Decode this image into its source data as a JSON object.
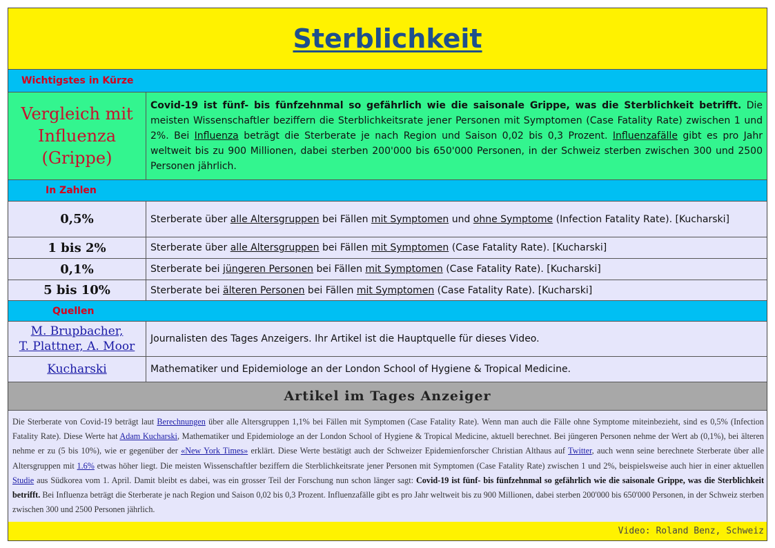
{
  "title": "Sterblichkeit",
  "sections": {
    "summary": "Wichtigstes in Kürze",
    "numbers": "In Zahlen",
    "sources": "Quellen"
  },
  "summary": {
    "left": "Vergleich mit Influenza (Grippe)",
    "bold": "Covid-19 ist fünf- bis fünfzehnmal so gefährlich wie die saisonale Grippe, was die Sterblichkeit betrifft.",
    "text1": " Die meisten Wissenschaftler beziffern die Sterblichkeitsrate jener Personen mit Symptomen (Case Fatality Rate) zwischen 1 und 2%. Bei ",
    "link1": "Influenza",
    "text2": " beträgt die Sterberate je nach Region und Saison 0,02 bis 0,3 Prozent. ",
    "link2": "Influenzafälle",
    "text3": " gibt es pro Jahr weltweit bis zu 900 Millionen, dabei sterben 200'000 bis 650'000 Personen, in der Schweiz sterben zwischen 300 und 2500 Personen jährlich."
  },
  "stats": [
    {
      "value": "0,5%",
      "t1": "Sterberate über ",
      "u1": "alle Altersgruppen",
      "t2": " bei Fällen ",
      "u2": "mit Symptomen",
      "t3": " und ",
      "u3": "ohne Symptome",
      "t4": " (Infection Fatality Rate). [Kucharski]"
    },
    {
      "value": "1 bis 2%",
      "t1": "Sterberate über ",
      "u1": "alle Altersgruppen",
      "t2": " bei Fällen ",
      "u2": "mit Symptomen",
      "t4": " (Case Fatality Rate). [Kucharski]"
    },
    {
      "value": "0,1%",
      "t1": "Sterberate bei ",
      "u1": "jüngeren Personen",
      "t2": " bei Fällen ",
      "u2": "mit Symptomen",
      "t4": " (Case Fatality Rate). [Kucharski]"
    },
    {
      "value": "5 bis 10%",
      "t1": "Sterberate bei ",
      "u1": "älteren Personen",
      "t2": " bei Fällen ",
      "u2": "mit Symptomen",
      "t4": " (Case Fatality Rate). [Kucharski]"
    }
  ],
  "sources": [
    {
      "name_line1": "M. Brupbacher,",
      "name_line2": "T. Plattner, A. Moor",
      "desc": "Journalisten des Tages Anzeigers. Ihr Artikel ist die Hauptquelle für dieses Video."
    },
    {
      "name_line1": "Kucharski",
      "desc": "Mathematiker und Epidemiologe an der London School of Hygiene & Tropical Medicine."
    }
  ],
  "article": {
    "heading": "Artikel im Tages Anzeiger",
    "p1": "Die Sterberate von Covid-19 beträgt laut ",
    "l1": "Berechnungen",
    "p2": " über alle Altersgruppen 1,1% bei Fällen mit Symptomen (Case Fatality Rate). Wenn man auch die Fälle ohne Symptome miteinbezieht, sind es 0,5% (Infection Fatality Rate). Diese Werte hat ",
    "l2": "Adam Kucharski",
    "p3": ", Mathematiker und Epidemiologe an der London School of Hygiene & Tropical Medicine, aktuell berechnet. Bei jüngeren Personen nehme der Wert ab (0,1%), bei älteren nehme er zu (5 bis 10%), wie er gegenüber der ",
    "l3": "«New York Times»",
    "p4": " erklärt. Diese Werte bestätigt auch der Schweizer Epidemienforscher Christian Althaus auf ",
    "l4": "Twitter",
    "p5": ", auch wenn seine berechnete Sterberate über alle Altersgruppen mit ",
    "l5": "1.6%",
    "p6": " etwas höher liegt. Die meisten Wissenschaftler beziffern die Sterblichkeitsrate jener Personen mit Symptomen (Case Fatality Rate) zwischen 1 und 2%, beispielsweise auch hier in einer aktuellen ",
    "l6": "Studie",
    "p7": " aus Südkorea vom 1. April. Damit bleibt es dabei, was ein grosser Teil der Forschung nun schon länger sagt: ",
    "bold": "Covid-19 ist fünf- bis fünfzehnmal so gefährlich wie die saisonale Grippe, was die Sterblichkeit betrifft.",
    "p8": " Bei Influenza beträgt die Sterberate je nach Region und Saison 0,02 bis 0,3 Prozent. Influenzafälle gibt es pro Jahr weltweit bis zu 900 Millionen, dabei sterben 200'000 bis 650'000 Personen, in der Schweiz sterben zwischen 300 und 2500 Personen jährlich."
  },
  "footer": "Video: Roland Benz, Schweiz"
}
